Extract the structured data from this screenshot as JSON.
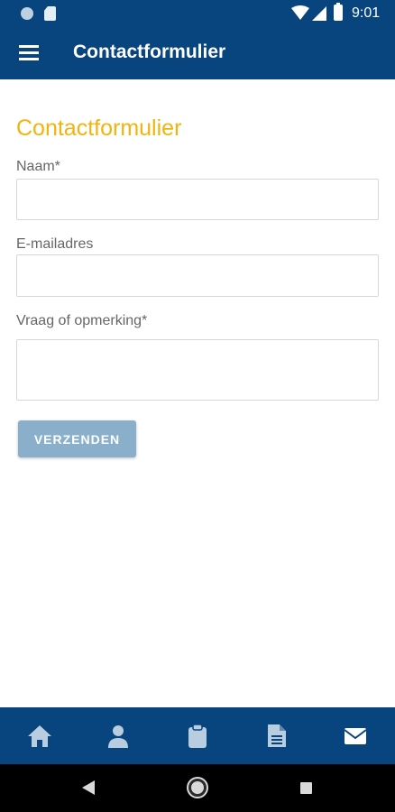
{
  "status_bar": {
    "time": "9:01",
    "icons": [
      "notification-dot-icon",
      "sim-card-icon",
      "wifi-icon",
      "cell-signal-icon",
      "battery-icon"
    ]
  },
  "app_bar": {
    "title": "Contactformulier",
    "menu_icon": "menu-icon"
  },
  "form": {
    "heading": "Contactformulier",
    "fields": [
      {
        "label": "Naam*",
        "value": ""
      },
      {
        "label": "E-mailadres",
        "value": ""
      },
      {
        "label": "Vraag of opmerking*",
        "value": ""
      }
    ],
    "submit_label": "VERZENDEN"
  },
  "bottom_nav": {
    "items": [
      "home-icon",
      "person-icon",
      "clipboard-icon",
      "document-icon",
      "mail-icon"
    ],
    "active": "mail-icon"
  },
  "system_nav": {
    "buttons": [
      "back-icon",
      "home-button-icon",
      "recents-icon"
    ]
  },
  "colors": {
    "primary": "#08457f",
    "accent": "#f1b40f",
    "button": "#8aafcb"
  }
}
